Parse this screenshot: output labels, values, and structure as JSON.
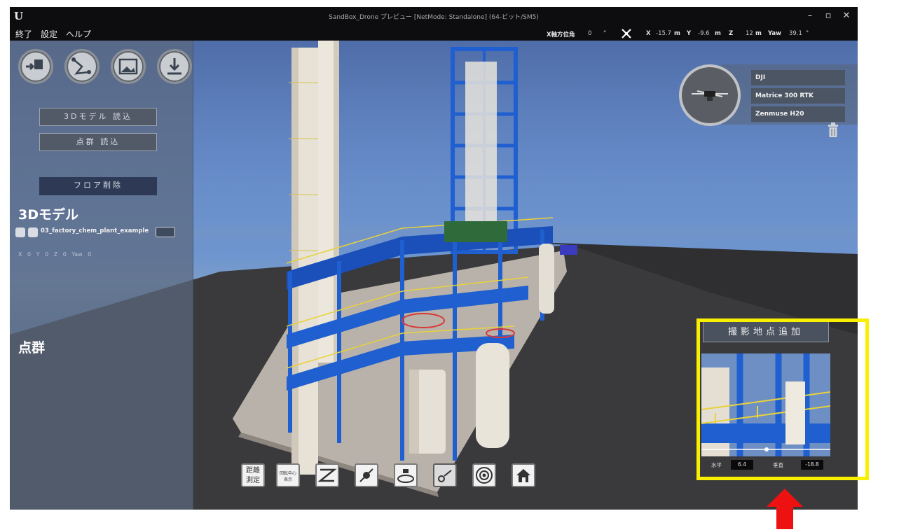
{
  "window": {
    "title": "SandBox_Drone プレビュー [NetMode: Standalone] (64-ビット/SM5)",
    "minimize": "–",
    "maximize": "▫",
    "close": "✕"
  },
  "menu": [
    "終了",
    "設定",
    "ヘルプ"
  ],
  "telemetry": {
    "x_heading_label": "X軸方位角",
    "x_heading_value": "0",
    "x_heading_unit": "°",
    "x_label": "X",
    "x_value": "-15.7",
    "y_label": "Y",
    "y_value": "-9.6",
    "z_label": "Z",
    "z_value": "12",
    "unit": "m",
    "yaw_label": "Yaw",
    "yaw_value": "39.1",
    "yaw_unit": "°"
  },
  "left_panel": {
    "tool_icons": [
      "import-icon",
      "route-icon",
      "image-icon",
      "download-icon"
    ],
    "load_model_label": "3Dモデル 読込",
    "load_pointcloud_label": "点群 読込",
    "delete_floor_label": "フロア削除",
    "model_section_title": "3Dモデル",
    "model_name": "03_factory_chem_plant_example",
    "model_coords": {
      "x_label": "X",
      "x": "0",
      "y_label": "Y",
      "y": "0",
      "z_label": "Z",
      "z": "0",
      "yaw_label": "Yaw",
      "yaw": "0"
    },
    "pointcloud_section_title": "点群"
  },
  "drone": {
    "maker": "DJI",
    "model": "Matrice 300 RTK",
    "camera": "Zenmuse H20"
  },
  "bottom_toolbar": {
    "measure_label_1": "距離",
    "measure_label_2": "測定",
    "rotate_center_label_1": "回転中心",
    "rotate_center_label_2": "表示"
  },
  "capture": {
    "add_point_label": "撮影地点追加",
    "horizontal_label": "水平",
    "horizontal_value": "6.4",
    "vertical_label": "垂直",
    "vertical_value": "-18.8"
  },
  "colors": {
    "highlight_box": "#f8f000",
    "arrow": "#ee1111",
    "floor": "#3a3a3c",
    "steel_blue": "#1f5fcf",
    "railing_yellow": "#e8d23a"
  }
}
